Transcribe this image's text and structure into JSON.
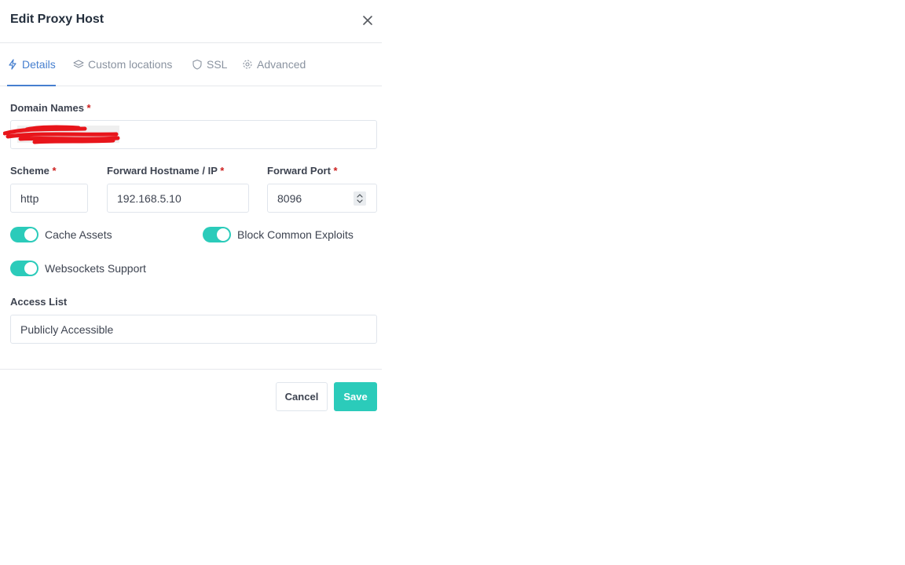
{
  "modal": {
    "title": "Edit Proxy Host",
    "close_icon": "close-icon"
  },
  "tabs": [
    {
      "label": "Details",
      "icon": "bolt-icon",
      "active": true
    },
    {
      "label": "Custom locations",
      "icon": "layers-icon",
      "active": false
    },
    {
      "label": "SSL",
      "icon": "shield-icon",
      "active": false
    },
    {
      "label": "Advanced",
      "icon": "gear-icon",
      "active": false
    }
  ],
  "form": {
    "domain_names": {
      "label": "Domain Names",
      "required_mark": "*"
    },
    "scheme": {
      "label": "Scheme",
      "required_mark": "*",
      "value": "http"
    },
    "forward_host": {
      "label": "Forward Hostname / IP",
      "required_mark": "*",
      "value": "192.168.5.10"
    },
    "forward_port": {
      "label": "Forward Port",
      "required_mark": "*",
      "value": "8096"
    },
    "toggles": [
      {
        "label": "Cache Assets",
        "on": true
      },
      {
        "label": "Block Common Exploits",
        "on": true
      },
      {
        "label": "Websockets Support",
        "on": true
      }
    ],
    "access_list": {
      "label": "Access List",
      "value": "Publicly Accessible"
    }
  },
  "footer": {
    "cancel_label": "Cancel",
    "save_label": "Save"
  },
  "colors": {
    "accent": "#2bcbba",
    "tab_active": "#467fcf",
    "required": "#cd201f",
    "redaction": "#e8151b"
  }
}
